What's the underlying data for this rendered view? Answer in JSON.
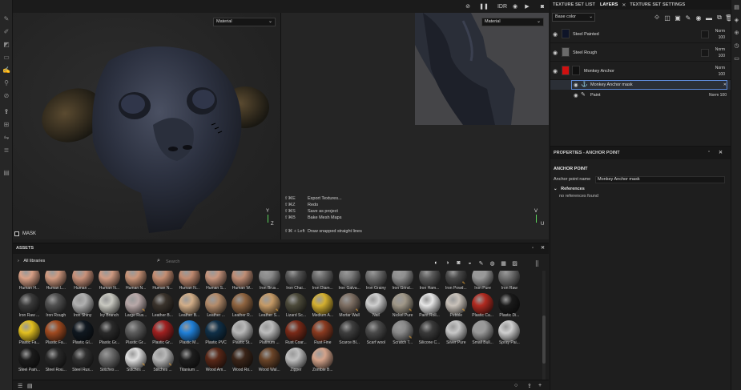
{
  "top_bar": {
    "icons": [
      "no-view-icon",
      "pause-icon",
      "render-mode-icon",
      "camera-icon",
      "video-icon",
      "screenshot-icon"
    ],
    "render_mode_label": "IDR"
  },
  "viewport_3d": {
    "material_dropdown": "Material",
    "axis_y": "Y",
    "axis_z": "Z",
    "mask_label": "MASK"
  },
  "viewport_2d": {
    "material_dropdown": "Material",
    "axis_y": "V",
    "axis_x": "U",
    "shortcuts": [
      {
        "key": "⇧⌘E",
        "label": "Export Textures..."
      },
      {
        "key": "⇧⌘Z",
        "label": "Redo"
      },
      {
        "key": "⇧⌘S",
        "label": "Save as project"
      },
      {
        "key": "⇧⌘B",
        "label": "Bake Mesh Maps"
      }
    ],
    "hint_key": "⇧⌘ + Left",
    "hint_label": "Draw snapped straight lines"
  },
  "panel_tabs": {
    "texture_set_list": "TEXTURE SET LIST",
    "layers": "LAYERS",
    "texture_set_settings": "TEXTURE SET SETTINGS"
  },
  "layers": {
    "channel": "Base color",
    "items": [
      {
        "name": "Steel Painted",
        "blend": "Norm",
        "opacity": "100"
      },
      {
        "name": "Steel Rough",
        "blend": "Norm",
        "opacity": "100"
      },
      {
        "name": "Monkey Anchor",
        "blend": "Norm",
        "opacity": "100"
      }
    ],
    "sub_items": [
      {
        "name": "Monkey Anchor mask"
      },
      {
        "name": "Paint",
        "blend": "Norm",
        "opacity": "100"
      }
    ]
  },
  "properties": {
    "header": "PROPERTIES - ANCHOR POINT",
    "section": "ANCHOR POINT",
    "anchor_name_label": "Anchor point name",
    "anchor_name_value": "Monkey Anchor mask",
    "references_label": "References",
    "references_empty": "no references found"
  },
  "assets": {
    "header": "ASSETS",
    "library": "All libraries",
    "search_placeholder": "Search",
    "items": [
      {
        "label": "Human H...",
        "color": "#d9a086"
      },
      {
        "label": "Human L...",
        "color": "#d19a80"
      },
      {
        "label": "Human ...",
        "color": "#c8917a"
      },
      {
        "label": "Human N...",
        "color": "#cf9a82"
      },
      {
        "label": "Human N...",
        "color": "#c99478"
      },
      {
        "label": "Human N...",
        "color": "#c48d72"
      },
      {
        "label": "Human N...",
        "color": "#c08a70"
      },
      {
        "label": "Human S...",
        "color": "#c7957d"
      },
      {
        "label": "Human W...",
        "color": "#bf8d75"
      },
      {
        "label": "Iron Brus...",
        "color": "#8a8a8a"
      },
      {
        "label": "Iron Chai...",
        "color": "#555555"
      },
      {
        "label": "Iron Diam...",
        "color": "#6a6a6a"
      },
      {
        "label": "Iron Galva...",
        "color": "#7c7c7c"
      },
      {
        "label": "Iron Grainy",
        "color": "#6e6e6e"
      },
      {
        "label": "Iron Grind...",
        "color": "#8f8f8f"
      },
      {
        "label": "Iron Ham...",
        "color": "#5b5b5b"
      },
      {
        "label": "Iron Powd...",
        "color": "#4a4a4a"
      },
      {
        "label": "Iron Pure",
        "color": "#999999"
      },
      {
        "label": "Iron Raw",
        "color": "#707070"
      },
      {
        "label": "Iron Raw ...",
        "color": "#3a3a3a"
      },
      {
        "label": "Iron Rough",
        "color": "#505050"
      },
      {
        "label": "Iron Shiny",
        "color": "#b0b0b0"
      },
      {
        "label": "Ivy Branch",
        "color": "#c8c8c0"
      },
      {
        "label": "Large Rus...",
        "color": "#b8a8a8"
      },
      {
        "label": "Leather B...",
        "color": "#3a332c"
      },
      {
        "label": "Leather B...",
        "color": "#d2ae88"
      },
      {
        "label": "Leather ...",
        "color": "#b38b6a"
      },
      {
        "label": "Leather R...",
        "color": "#8f6440"
      },
      {
        "label": "Leather S...",
        "color": "#c59a66"
      },
      {
        "label": "Lizard Sc...",
        "color": "#4c4a3a"
      },
      {
        "label": "Medium A...",
        "color": "#d4b030"
      },
      {
        "label": "Mortar Wall",
        "color": "#7d6e62"
      },
      {
        "label": "Nail",
        "color": "#cfcfcf"
      },
      {
        "label": "Nickel Pure",
        "color": "#a09888"
      },
      {
        "label": "Paint Roll...",
        "color": "#e6e6e6"
      },
      {
        "label": "Pebble",
        "color": "#c9c2ba"
      },
      {
        "label": "Plastic Ca...",
        "color": "#b02a20"
      },
      {
        "label": "Plastic Di...",
        "color": "#1a1a1a"
      },
      {
        "label": "Plastic Fa...",
        "color": "#e3c020"
      },
      {
        "label": "Plastic Fa...",
        "color": "#a04a20"
      },
      {
        "label": "Plastic Gl...",
        "color": "#101820"
      },
      {
        "label": "Plastic Gr...",
        "color": "#2a2a2a"
      },
      {
        "label": "Plastic Gr...",
        "color": "#5c5c5c"
      },
      {
        "label": "Plastic Gr...",
        "color": "#a02020"
      },
      {
        "label": "Plastic M...",
        "color": "#2080d8"
      },
      {
        "label": "Plastic PVC",
        "color": "#103048"
      },
      {
        "label": "Plastic St...",
        "color": "#b8b8b8"
      },
      {
        "label": "Platinum ...",
        "color": "#bcbcbc"
      },
      {
        "label": "Rust Coar...",
        "color": "#7a2a18"
      },
      {
        "label": "Rust Fine",
        "color": "#8a3a20"
      },
      {
        "label": "Scarce Bl...",
        "color": "#3e3e3e"
      },
      {
        "label": "Scarf wool",
        "color": "#4a4a4a"
      },
      {
        "label": "Scratch T...",
        "color": "#8a8a8a"
      },
      {
        "label": "Silicone C...",
        "color": "#3a3a3a"
      },
      {
        "label": "Silver Pure",
        "color": "#c8c8c8"
      },
      {
        "label": "Small Bull...",
        "color": "#9a9a9a"
      },
      {
        "label": "Spray Pai...",
        "color": "#cfcfcf"
      },
      {
        "label": "Steel Pain...",
        "color": "#1c1c1c"
      },
      {
        "label": "Steel Rou...",
        "color": "#2a2a2a"
      },
      {
        "label": "Steel Rus...",
        "color": "#303030"
      },
      {
        "label": "Stitches ...",
        "color": "#6a6a6a"
      },
      {
        "label": "Stitches ...",
        "color": "#e0e0e0"
      },
      {
        "label": "Stitches ...",
        "color": "#b8b8b8"
      },
      {
        "label": "Titanium ...",
        "color": "#1e1e1e"
      },
      {
        "label": "Wood Am...",
        "color": "#5a2818"
      },
      {
        "label": "Wood Ro...",
        "color": "#3a2418"
      },
      {
        "label": "Wood Wal...",
        "color": "#6a4428"
      },
      {
        "label": "Zipper",
        "color": "#c0c0c0"
      },
      {
        "label": "Zombie B...",
        "color": "#d4a38a"
      }
    ]
  },
  "colors": {
    "accent": "#5e8ad8",
    "badge": "#e8a43a",
    "layer_red": "#d01010"
  }
}
